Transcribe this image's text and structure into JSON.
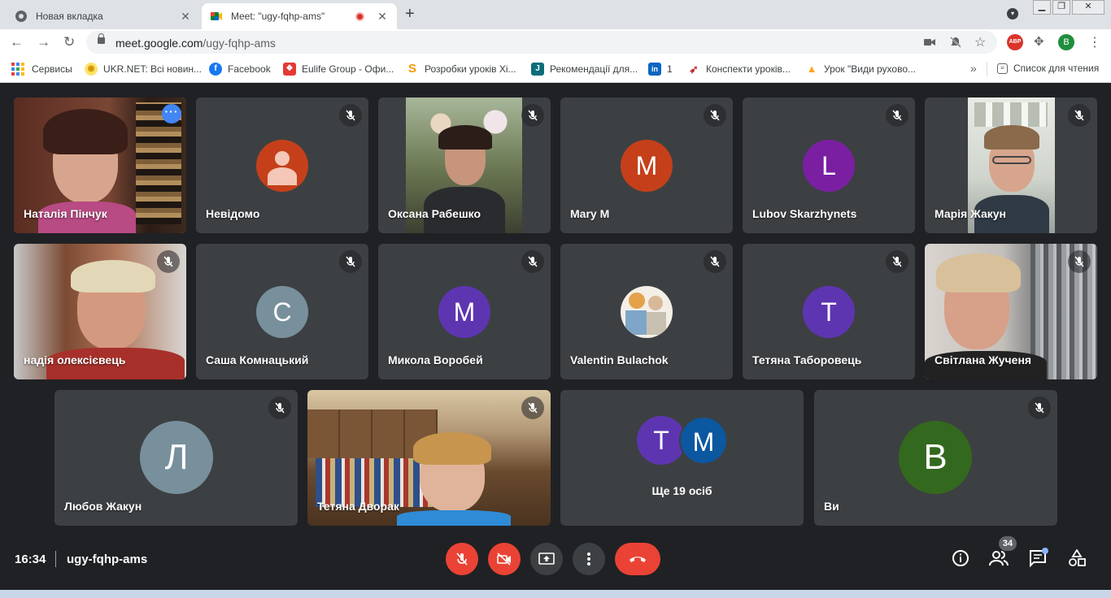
{
  "browser": {
    "tabs": [
      {
        "title": "Новая вкладка",
        "active": false
      },
      {
        "title": "Meet: \"ugy-fqhp-ams\"",
        "active": true,
        "recording": true
      }
    ],
    "new_tab": "+",
    "url_host": "meet.google.com",
    "url_path": "/ugy-fqhp-ams",
    "profile_initial": "B",
    "abp_label": "ABP",
    "bookmarks": [
      {
        "label": "Сервисы"
      },
      {
        "label": "UKR.NET: Всі новин..."
      },
      {
        "label": "Facebook"
      },
      {
        "label": "Eulife Group - Офи..."
      },
      {
        "label": "Розробки уроків Хі..."
      },
      {
        "label": "Рекомендації для..."
      },
      {
        "label": "1"
      },
      {
        "label": "Конспекти уроків..."
      },
      {
        "label": "Урок \"Види рухово..."
      }
    ],
    "more_bookmarks": "»",
    "reading_list": "Список для чтения"
  },
  "participants": [
    {
      "name": "Наталія Пінчук",
      "type": "video",
      "selected": true
    },
    {
      "name": "Невідомо",
      "type": "anon"
    },
    {
      "name": "Оксана Рабешко",
      "type": "video"
    },
    {
      "name": "Mary M",
      "initial": "M",
      "color": "#c5401a"
    },
    {
      "name": "Lubov Skarzhynets",
      "initial": "L",
      "color": "#7b1fa2"
    },
    {
      "name": "Марія Жакун",
      "type": "video"
    },
    {
      "name": "надія олексієвець",
      "type": "video"
    },
    {
      "name": "Саша Комнацький",
      "initial": "С",
      "color": "#78909c"
    },
    {
      "name": "Микола Воробей",
      "initial": "М",
      "color": "#5e35b1"
    },
    {
      "name": "Valentin Bulachok",
      "type": "photo-avatar"
    },
    {
      "name": "Тетяна Таборовець",
      "initial": "Т",
      "color": "#5e35b1"
    },
    {
      "name": "Світлана Жученя",
      "type": "video"
    },
    {
      "name": "Любов Жакун",
      "initial": "Л",
      "color": "#78909c"
    },
    {
      "name": "Тетяна Дворак",
      "type": "video"
    },
    {
      "name": "Ще 19 осіб",
      "type": "overflow",
      "initials": [
        "Т",
        "M"
      ],
      "colors": [
        "#5e35b1",
        "#0b57a0"
      ]
    },
    {
      "name": "Ви",
      "initial": "B",
      "color": "#33691e"
    }
  ],
  "bottom_bar": {
    "time": "16:34",
    "meeting_code": "ugy-fqhp-ams",
    "participants_count": "34"
  },
  "colors": {
    "meet_bg": "#202124",
    "tile_bg": "#3c4043",
    "danger": "#ea4335",
    "accent": "#8ab4f8"
  }
}
